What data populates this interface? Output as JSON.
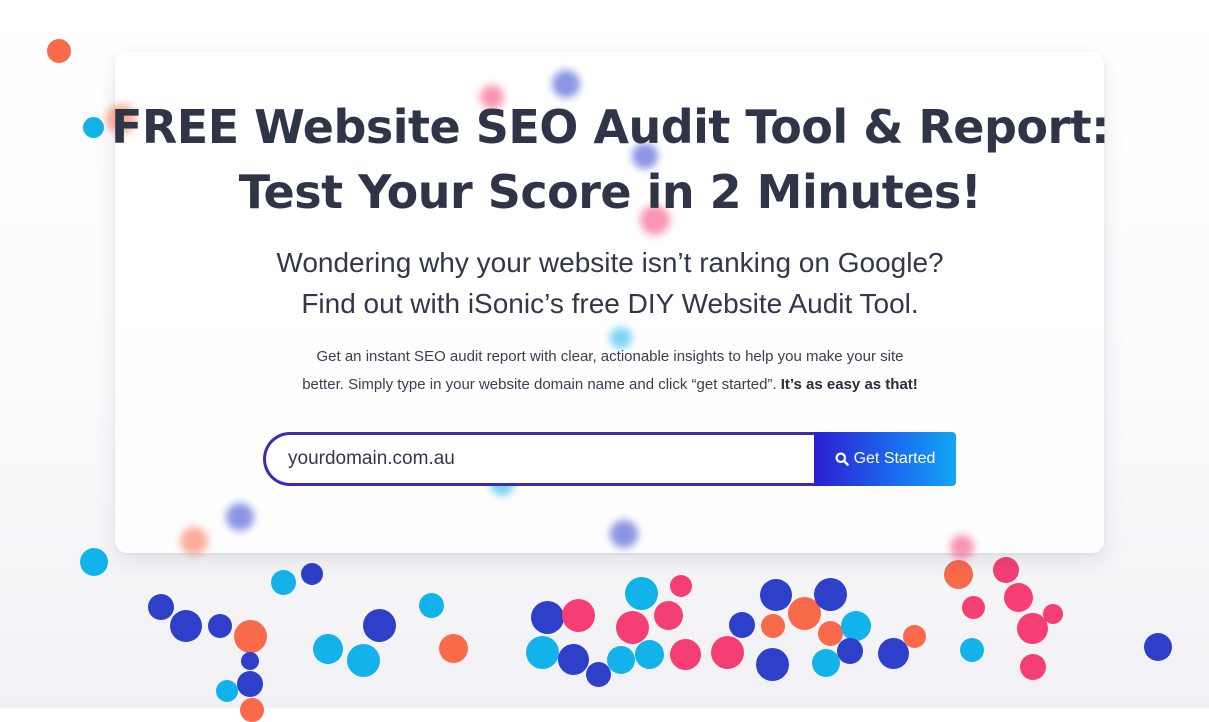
{
  "hero": {
    "title_line1": "FREE Website SEO Audit Tool & Report:",
    "title_line2": "Test Your Score in 2 Minutes!",
    "subtitle_line1": "Wondering why your website isn’t ranking on Google?",
    "subtitle_line2": "Find out with iSonic’s free DIY Website Audit Tool.",
    "description_line1": "Get an instant SEO audit report with clear, actionable insights to help you make your site",
    "description_line2_prefix": "better. Simply type in your website domain name and click “get started”. ",
    "description_line2_bold": "It’s as easy as that!"
  },
  "search": {
    "placeholder": "yourdomain.com.au",
    "button_label": "Get Started",
    "button_icon": "search-icon"
  },
  "colors": {
    "headline": "#2f3447",
    "input_border": "#3a2bb8",
    "button_gradient_start": "#2b1fd0",
    "button_gradient_end": "#12a6f3",
    "dot_orange": "#f96a4a",
    "dot_pink": "#f53f74",
    "dot_blue": "#2e3fc9",
    "dot_cyan": "#12b3ea"
  }
}
